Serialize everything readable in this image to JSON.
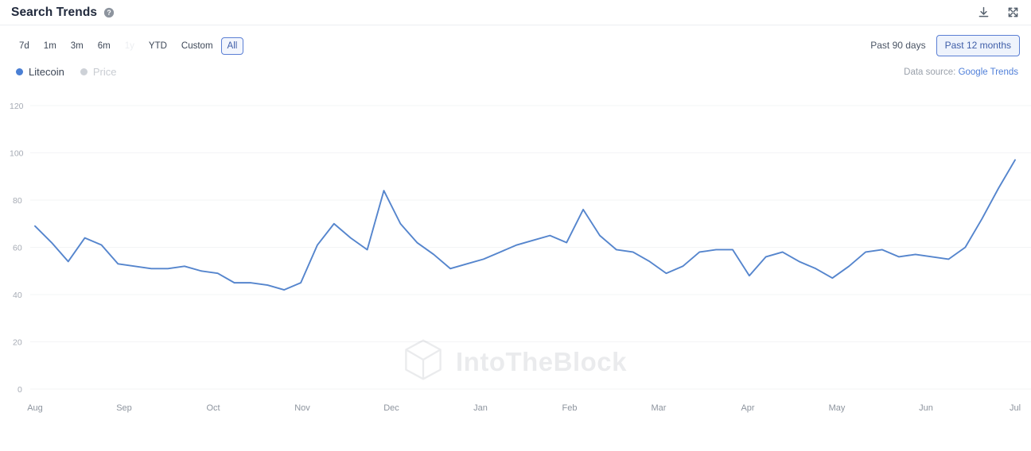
{
  "header": {
    "title": "Search Trends",
    "help_icon": "question-mark-circle-icon",
    "download_icon": "download-icon",
    "expand_icon": "fullscreen-expand-icon"
  },
  "controls": {
    "ranges": [
      {
        "label": "7d",
        "state": "normal"
      },
      {
        "label": "1m",
        "state": "normal"
      },
      {
        "label": "3m",
        "state": "normal"
      },
      {
        "label": "6m",
        "state": "normal"
      },
      {
        "label": "1y",
        "state": "disabled"
      },
      {
        "label": "YTD",
        "state": "normal"
      },
      {
        "label": "Custom",
        "state": "normal"
      },
      {
        "label": "All",
        "state": "active"
      }
    ],
    "periods": [
      {
        "label": "Past 90 days",
        "state": "normal"
      },
      {
        "label": "Past 12 months",
        "state": "active"
      }
    ]
  },
  "legend": {
    "items": [
      {
        "label": "Litecoin",
        "color": "#4a7fd4",
        "active": true
      },
      {
        "label": "Price",
        "color": "#cdd1d7",
        "active": false
      }
    ]
  },
  "source": {
    "prefix": "Data source:",
    "link_label": "Google Trends"
  },
  "watermark": {
    "text": "IntoTheBlock",
    "logo_icon": "cube-logo-icon"
  },
  "colors": {
    "accent": "#4a7fd4",
    "line": "#5585cd",
    "selected_border": "#5b7fd4",
    "selected_fill": "#eef3fc",
    "text": "#2f3b52",
    "muted": "#9aa1ab",
    "grid": "#f3f4f6"
  },
  "chart_data": {
    "type": "line",
    "title": "Search Trends",
    "xlabel": "",
    "ylabel": "",
    "ylim": [
      0,
      120
    ],
    "yticks": [
      0,
      20,
      40,
      60,
      80,
      100,
      120
    ],
    "grid": true,
    "legend_position": "top-left",
    "xlabel_ticks": [
      "Aug",
      "Sep",
      "Oct",
      "Nov",
      "Dec",
      "Jan",
      "Feb",
      "Mar",
      "Apr",
      "May",
      "Jun",
      "Jul"
    ],
    "series": [
      {
        "name": "Litecoin",
        "color": "#5585cd",
        "values": [
          69,
          62,
          54,
          64,
          61,
          53,
          52,
          51,
          51,
          52,
          50,
          49,
          45,
          45,
          44,
          42,
          45,
          61,
          70,
          64,
          59,
          84,
          70,
          62,
          57,
          51,
          53,
          55,
          58,
          61,
          63,
          65,
          62,
          76,
          65,
          59,
          58,
          54,
          49,
          52,
          58,
          59,
          59,
          48,
          56,
          58,
          54,
          51,
          47,
          52,
          58,
          59,
          56,
          57,
          56,
          55,
          60,
          72,
          85,
          97
        ]
      }
    ]
  }
}
